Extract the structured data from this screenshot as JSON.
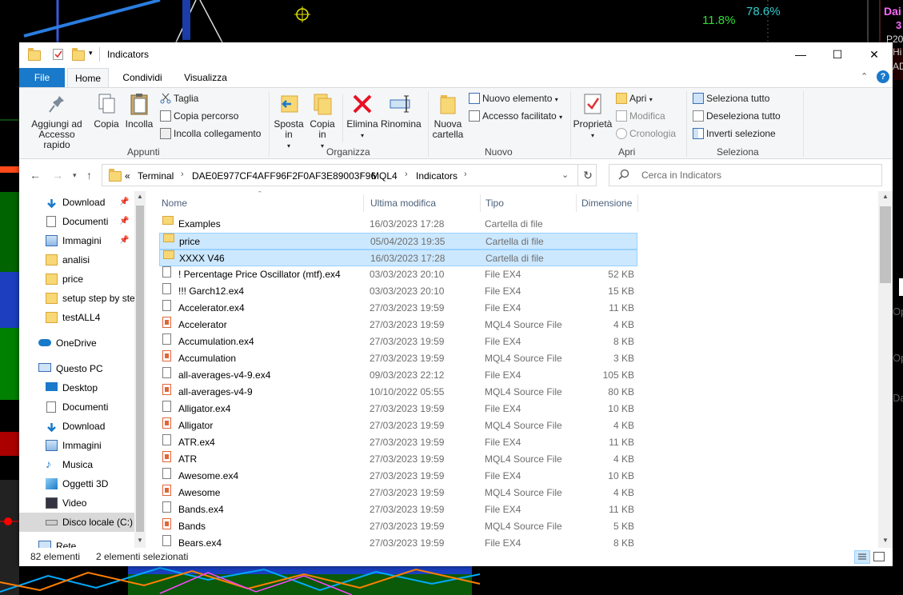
{
  "background": {
    "pct1": "11.8%",
    "pct2": "78.6%",
    "right_edge": [
      "Dai",
      "3",
      "P20",
      "Hi",
      "AD",
      "Op",
      "Op",
      "Da"
    ]
  },
  "window": {
    "title": "Indicators",
    "controls": {
      "minimize": "—",
      "maximize": "☐",
      "close": "✕"
    }
  },
  "tabs": [
    {
      "label": "File",
      "active": false
    },
    {
      "label": "Home",
      "active": true
    },
    {
      "label": "Condividi",
      "active": false
    },
    {
      "label": "Visualizza",
      "active": false
    }
  ],
  "ribbon": {
    "appunti": {
      "label": "Appunti",
      "pin_label": "Aggiungi ad Accesso rapido",
      "copy_label": "Copia",
      "paste_label": "Incolla",
      "cut_label": "Taglia",
      "copypath_label": "Copia percorso",
      "pasteshortcut_label": "Incolla collegamento"
    },
    "organizza": {
      "label": "Organizza",
      "move_label": "Sposta in",
      "copyto_label": "Copia in",
      "delete_label": "Elimina",
      "rename_label": "Rinomina"
    },
    "nuovo": {
      "label": "Nuovo",
      "newfolder_label": "Nuova cartella",
      "newitem_label": "Nuovo elemento",
      "easyaccess_label": "Accesso facilitato"
    },
    "apri": {
      "label": "Apri",
      "properties_label": "Proprietà",
      "open_label": "Apri",
      "edit_label": "Modifica",
      "history_label": "Cronologia"
    },
    "seleziona": {
      "label": "Seleziona",
      "selectall_label": "Seleziona tutto",
      "deselectall_label": "Deseleziona tutto",
      "invert_label": "Inverti selezione"
    }
  },
  "address": {
    "crumbs": [
      "Terminal",
      "DAE0E977CF4AFF96F2F0AF3E89003F96",
      "MQL4",
      "Indicators"
    ],
    "overflow": "«",
    "search_placeholder": "Cerca in Indicators"
  },
  "nav": {
    "quick": [
      {
        "label": "Download",
        "pinned": true,
        "icon": "download-icon"
      },
      {
        "label": "Documenti",
        "pinned": true,
        "icon": "documents-icon"
      },
      {
        "label": "Immagini",
        "pinned": true,
        "icon": "pictures-icon"
      },
      {
        "label": "analisi",
        "pinned": false,
        "icon": "folder-icon"
      },
      {
        "label": "price",
        "pinned": false,
        "icon": "folder-icon"
      },
      {
        "label": "setup step by ste",
        "pinned": false,
        "icon": "folder-icon"
      },
      {
        "label": "testALL4",
        "pinned": false,
        "icon": "folder-icon"
      }
    ],
    "onedrive": "OneDrive",
    "thispc": "Questo PC",
    "pc_items": [
      {
        "label": "Desktop",
        "icon": "desktop-icon"
      },
      {
        "label": "Documenti",
        "icon": "documents-icon"
      },
      {
        "label": "Download",
        "icon": "download-icon"
      },
      {
        "label": "Immagini",
        "icon": "pictures-icon"
      },
      {
        "label": "Musica",
        "icon": "music-icon"
      },
      {
        "label": "Oggetti 3D",
        "icon": "objects3d-icon"
      },
      {
        "label": "Video",
        "icon": "video-icon"
      },
      {
        "label": "Disco locale (C:)",
        "icon": "drive-icon",
        "selected": true
      }
    ],
    "network": "Rete"
  },
  "columns": {
    "name": "Nome",
    "date": "Ultima modifica",
    "type": "Tipo",
    "size": "Dimensione"
  },
  "files": [
    {
      "name": "Examples",
      "date": "16/03/2023 17:28",
      "type": "Cartella di file",
      "size": "",
      "kind": "folder",
      "selected": false
    },
    {
      "name": "price",
      "date": "05/04/2023 19:35",
      "type": "Cartella di file",
      "size": "",
      "kind": "folder",
      "selected": true
    },
    {
      "name": "XXXX V46",
      "date": "16/03/2023 17:28",
      "type": "Cartella di file",
      "size": "",
      "kind": "folder",
      "selected": true
    },
    {
      "name": "! Percentage Price Oscillator (mtf).ex4",
      "date": "03/03/2023 20:10",
      "type": "File EX4",
      "size": "52 KB",
      "kind": "ex4",
      "selected": false
    },
    {
      "name": "!!! Garch12.ex4",
      "date": "03/03/2023 20:10",
      "type": "File EX4",
      "size": "15 KB",
      "kind": "ex4",
      "selected": false
    },
    {
      "name": "Accelerator.ex4",
      "date": "27/03/2023 19:59",
      "type": "File EX4",
      "size": "11 KB",
      "kind": "ex4",
      "selected": false
    },
    {
      "name": "Accelerator",
      "date": "27/03/2023 19:59",
      "type": "MQL4 Source File",
      "size": "4 KB",
      "kind": "src",
      "selected": false
    },
    {
      "name": "Accumulation.ex4",
      "date": "27/03/2023 19:59",
      "type": "File EX4",
      "size": "8 KB",
      "kind": "ex4",
      "selected": false
    },
    {
      "name": "Accumulation",
      "date": "27/03/2023 19:59",
      "type": "MQL4 Source File",
      "size": "3 KB",
      "kind": "src",
      "selected": false
    },
    {
      "name": "all-averages-v4-9.ex4",
      "date": "09/03/2023 22:12",
      "type": "File EX4",
      "size": "105 KB",
      "kind": "ex4",
      "selected": false
    },
    {
      "name": "all-averages-v4-9",
      "date": "10/10/2022 05:55",
      "type": "MQL4 Source File",
      "size": "80 KB",
      "kind": "src",
      "selected": false
    },
    {
      "name": "Alligator.ex4",
      "date": "27/03/2023 19:59",
      "type": "File EX4",
      "size": "10 KB",
      "kind": "ex4",
      "selected": false
    },
    {
      "name": "Alligator",
      "date": "27/03/2023 19:59",
      "type": "MQL4 Source File",
      "size": "4 KB",
      "kind": "src",
      "selected": false
    },
    {
      "name": "ATR.ex4",
      "date": "27/03/2023 19:59",
      "type": "File EX4",
      "size": "11 KB",
      "kind": "ex4",
      "selected": false
    },
    {
      "name": "ATR",
      "date": "27/03/2023 19:59",
      "type": "MQL4 Source File",
      "size": "4 KB",
      "kind": "src",
      "selected": false
    },
    {
      "name": "Awesome.ex4",
      "date": "27/03/2023 19:59",
      "type": "File EX4",
      "size": "10 KB",
      "kind": "ex4",
      "selected": false
    },
    {
      "name": "Awesome",
      "date": "27/03/2023 19:59",
      "type": "MQL4 Source File",
      "size": "4 KB",
      "kind": "src",
      "selected": false
    },
    {
      "name": "Bands.ex4",
      "date": "27/03/2023 19:59",
      "type": "File EX4",
      "size": "11 KB",
      "kind": "ex4",
      "selected": false
    },
    {
      "name": "Bands",
      "date": "27/03/2023 19:59",
      "type": "MQL4 Source File",
      "size": "5 KB",
      "kind": "src",
      "selected": false
    },
    {
      "name": "Bears.ex4",
      "date": "27/03/2023 19:59",
      "type": "File EX4",
      "size": "8 KB",
      "kind": "ex4",
      "selected": false
    }
  ],
  "status": {
    "count": "82 elementi",
    "selection": "2 elementi selezionati"
  },
  "colors": {
    "accent": "#1979ca",
    "selection": "#cce8ff",
    "selection_border": "#99d1ff"
  }
}
